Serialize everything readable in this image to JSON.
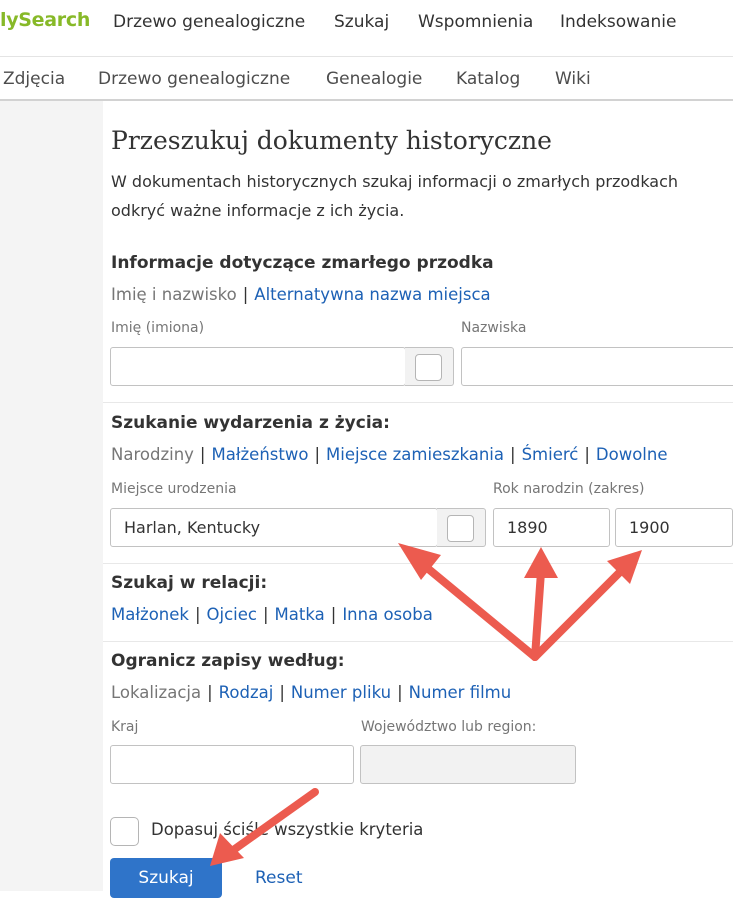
{
  "header": {
    "logo_text": "lySearch",
    "nav": [
      "Drzewo genealogiczne",
      "Szukaj",
      "Wspomnienia",
      "Indeksowanie"
    ]
  },
  "subnav": [
    "Zdjęcia",
    "Drzewo genealogiczne",
    "Genealogie",
    "Katalog",
    "Wiki"
  ],
  "page": {
    "title": "Przeszukuj dokumenty historyczne",
    "intro_line1": "W dokumentach historycznych szukaj informacji o zmarłych przodkach",
    "intro_line2": "odkryć ważne informacje z ich życia."
  },
  "deceased": {
    "title": "Informacje dotyczące zmarłego przodka",
    "tab_active": "Imię i nazwisko",
    "tab_link": "Alternatywna nazwa miejsca",
    "given_name_label": "Imię (imiona)",
    "given_name_value": "",
    "surname_label": "Nazwiska",
    "surname_value": ""
  },
  "life_event": {
    "title": "Szukanie wydarzenia z życia:",
    "tab_active": "Narodziny",
    "tabs": [
      "Małżeństwo",
      "Miejsce zamieszkania",
      "Śmierć",
      "Dowolne"
    ],
    "place_label": "Miejsce urodzenia",
    "place_value": "Harlan, Kentucky",
    "year_label": "Rok narodzin (zakres)",
    "year_from": "1890",
    "year_to": "1900"
  },
  "relationship": {
    "title": "Szukaj w relacji:",
    "tabs": [
      "Małżonek",
      "Ojciec",
      "Matka",
      "Inna osoba"
    ]
  },
  "restrict": {
    "title": "Ogranicz zapisy według:",
    "tab_active": "Lokalizacja",
    "tabs": [
      "Rodzaj",
      "Numer pliku",
      "Numer filmu"
    ],
    "country_label": "Kraj",
    "country_value": "",
    "region_label": "Województwo lub region:",
    "region_value": ""
  },
  "match_all_label": "Dopasuj ściśle wszystkie kryteria",
  "buttons": {
    "search": "Szukaj",
    "reset": "Reset"
  },
  "colors": {
    "logo": "#87b928",
    "link": "#1d61b5",
    "button": "#2f74c9",
    "annotation_arrow": "#ec5b4f"
  }
}
